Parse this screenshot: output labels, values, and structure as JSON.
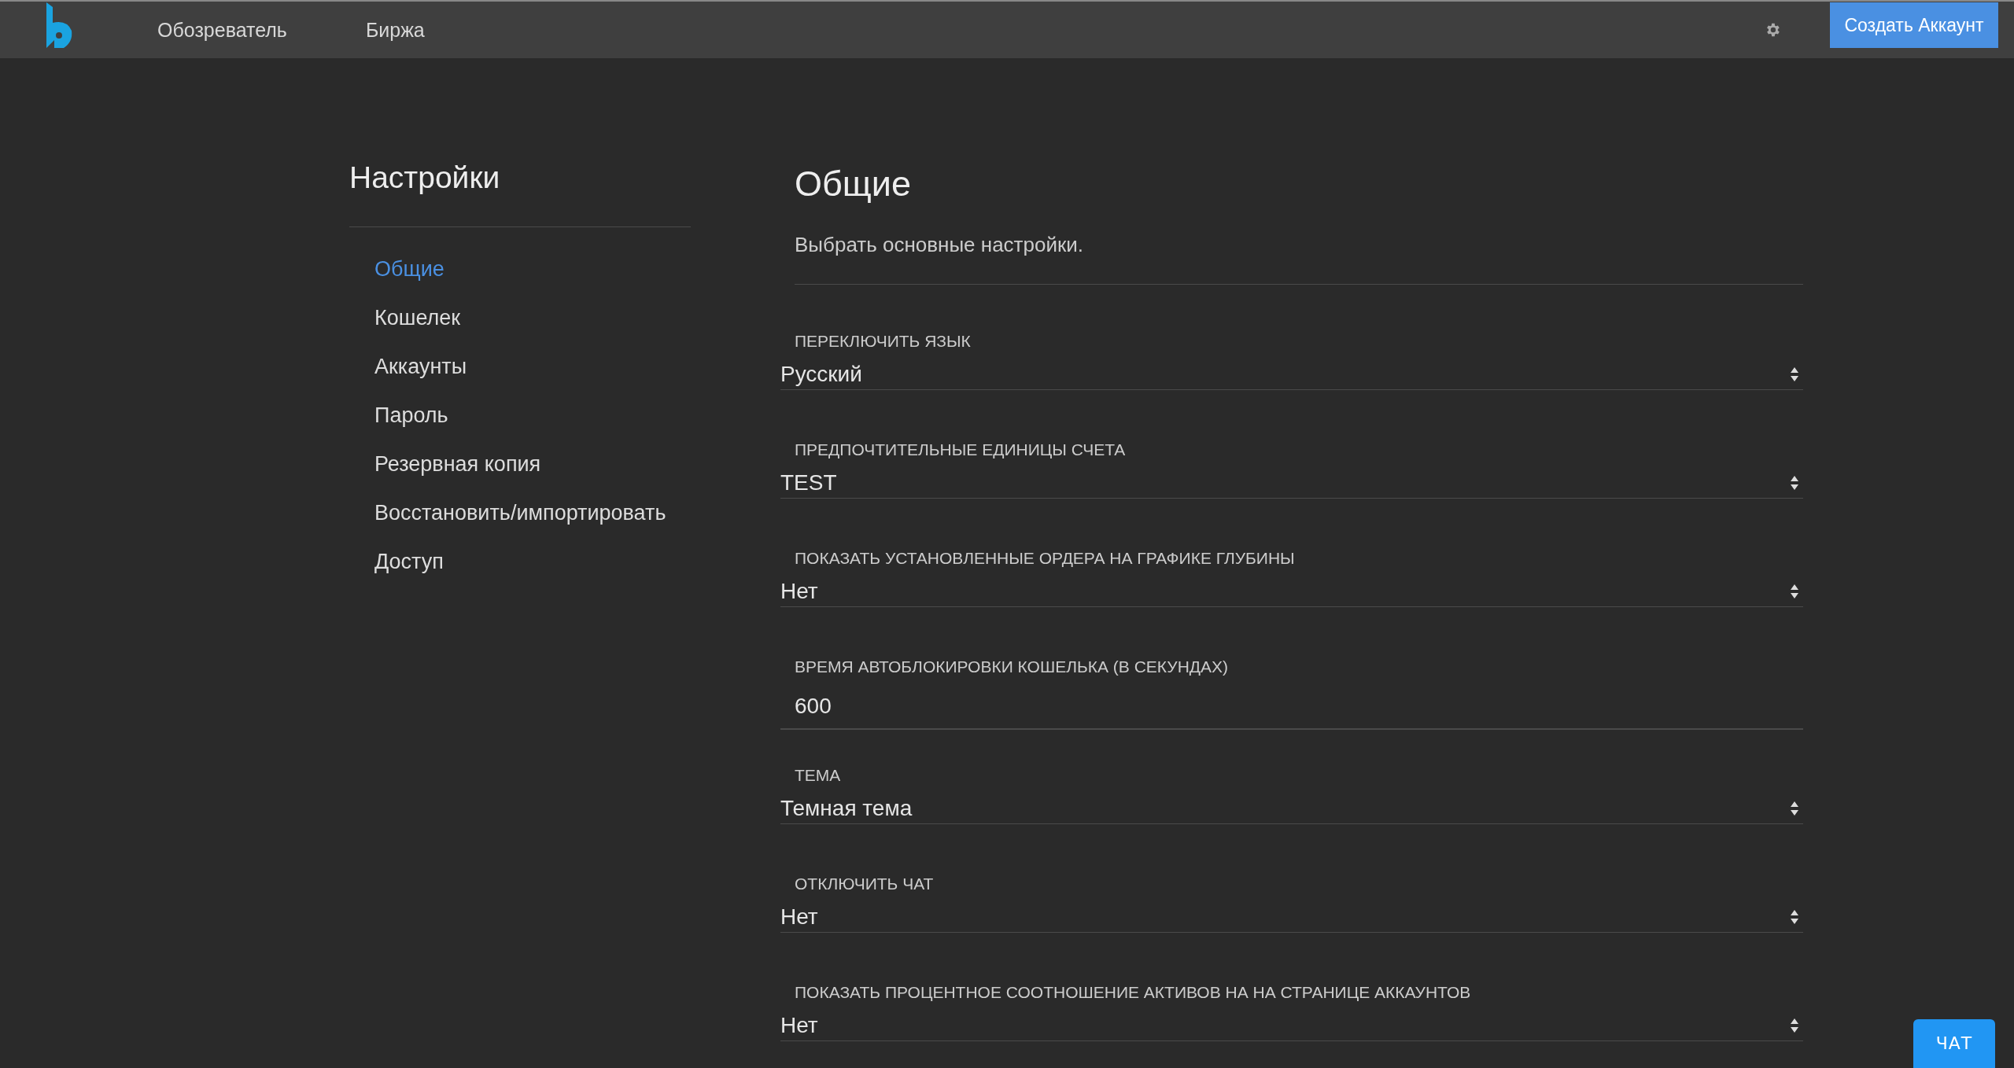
{
  "topbar": {
    "nav": [
      {
        "label": "Обозреватель"
      },
      {
        "label": "Биржа"
      }
    ],
    "create_account_button": "Создать Аккаунт"
  },
  "sidebar": {
    "title": "Настройки",
    "items": [
      {
        "label": "Общие",
        "selected": true
      },
      {
        "label": "Кошелек",
        "selected": false
      },
      {
        "label": "Аккаунты",
        "selected": false
      },
      {
        "label": "Пароль",
        "selected": false
      },
      {
        "label": "Резервная копия",
        "selected": false
      },
      {
        "label": "Восстановить/импортировать",
        "selected": false
      },
      {
        "label": "Доступ",
        "selected": false
      }
    ]
  },
  "main": {
    "title": "Общие",
    "subtitle": "Выбрать основные настройки.",
    "fields": [
      {
        "kind": "select",
        "label": "ПЕРЕКЛЮЧИТЬ ЯЗЫК",
        "value": "Русский"
      },
      {
        "kind": "select",
        "label": "ПРЕДПОЧТИТЕЛЬНЫЕ ЕДИНИЦЫ СЧЕТА",
        "value": "TEST"
      },
      {
        "kind": "select",
        "label": "ПОКАЗАТЬ УСТАНОВЛЕННЫЕ ОРДЕРА НА ГРАФИКЕ ГЛУБИНЫ",
        "value": "Нет"
      },
      {
        "kind": "input",
        "label": "ВРЕМЯ АВТОБЛОКИРОВКИ КОШЕЛЬКА (В СЕКУНДАХ)",
        "value": "600"
      },
      {
        "kind": "select",
        "label": "ТЕМА",
        "value": "Темная тема"
      },
      {
        "kind": "select",
        "label": "ОТКЛЮЧИТЬ ЧАТ",
        "value": "Нет"
      },
      {
        "kind": "select",
        "label": "ПОКАЗАТЬ ПРОЦЕНТНОЕ СООТНОШЕНИЕ АКТИВОВ НА НА СТРАНИЦЕ АККАУНТОВ",
        "value": "Нет"
      }
    ]
  },
  "chat_button": "ЧАТ"
}
